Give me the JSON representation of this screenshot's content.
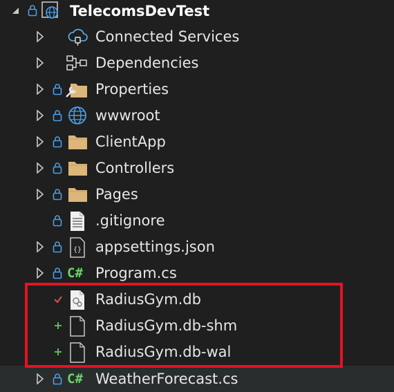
{
  "solution_explorer": {
    "project": {
      "label": "TelecomsDevTest"
    },
    "items": [
      {
        "label": "Connected Services"
      },
      {
        "label": "Dependencies"
      },
      {
        "label": "Properties"
      },
      {
        "label": "wwwroot"
      },
      {
        "label": "ClientApp"
      },
      {
        "label": "Controllers"
      },
      {
        "label": "Pages"
      },
      {
        "label": ".gitignore"
      },
      {
        "label": "appsettings.json"
      },
      {
        "label": "Program.cs"
      },
      {
        "label": "RadiusGym.db"
      },
      {
        "label": "RadiusGym.db-shm"
      },
      {
        "label": "RadiusGym.db-wal"
      },
      {
        "label": "WeatherForecast.cs"
      }
    ],
    "csharp_glyph": "C#",
    "json_glyph": "{}"
  },
  "colors": {
    "background": "#1f1f1f",
    "hover_row": "#2a2d2e",
    "highlight_box": "#e81123",
    "folder": "#dcb67a",
    "globe": "#4a9fe8",
    "csharp": "#6ad36a",
    "status_added": "#5cb85c",
    "status_modified": "#d9534f"
  }
}
